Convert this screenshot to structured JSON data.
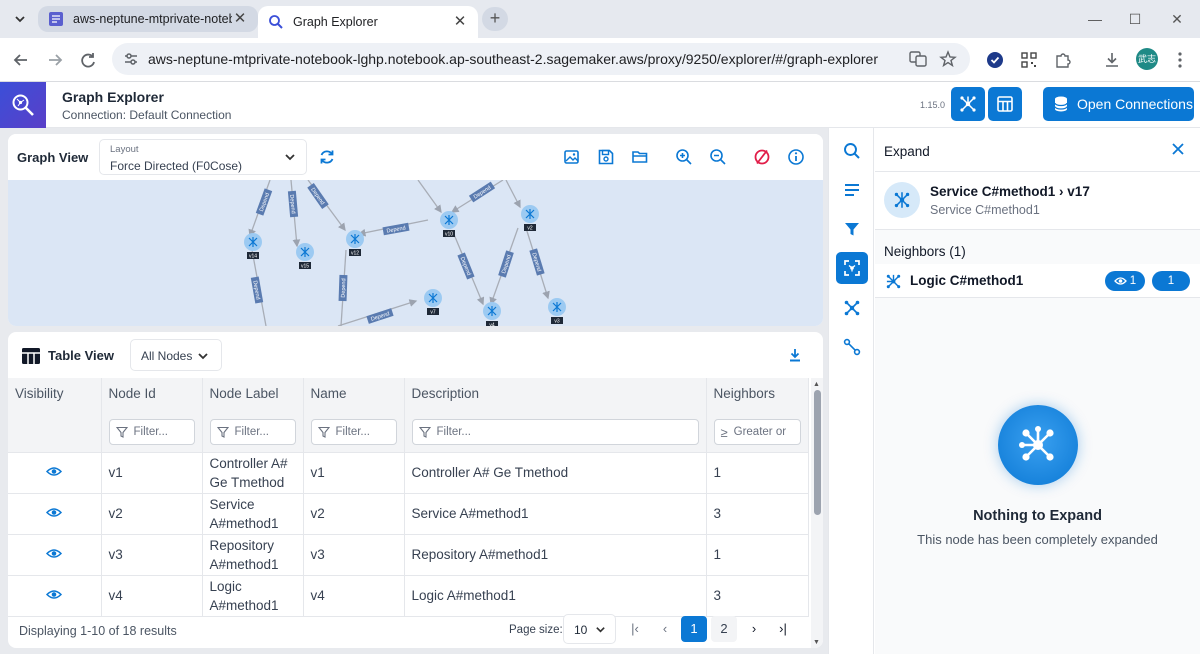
{
  "browser": {
    "tabs": [
      {
        "title": "aws-neptune-mtprivate-notebo",
        "active": false
      },
      {
        "title": "Graph Explorer",
        "active": true
      }
    ],
    "url": "aws-neptune-mtprivate-notebook-lghp.notebook.ap-southeast-2.sagemaker.aws/proxy/9250/explorer/#/graph-explorer",
    "profile_label": "武志"
  },
  "app": {
    "title": "Graph Explorer",
    "connection": "Connection: Default Connection",
    "version": "1.15.0",
    "open_connections_label": "Open Connections",
    "accent_color": "#0b78d4"
  },
  "graph_view": {
    "title": "Graph View",
    "layout_label": "Layout",
    "layout_value": "Force Directed (F0Cose)",
    "node_labels": [
      "v14",
      "v15",
      "v12",
      "v10",
      "v2",
      "v7",
      "v4",
      "v3"
    ],
    "edge_label": "Depend"
  },
  "table_view": {
    "title": "Table View",
    "filter_select": "All Nodes",
    "columns": [
      "Visibility",
      "Node Id",
      "Node Label",
      "Name",
      "Description",
      "Neighbors"
    ],
    "filter_placeholder": "Filter...",
    "neighbors_filter_placeholder": "Greater or",
    "rows": [
      {
        "id": "v1",
        "label": "Controller A# Ge Tmethod",
        "name": "v1",
        "description": "Controller A# Ge Tmethod",
        "neighbors": "1"
      },
      {
        "id": "v2",
        "label": "Service A#method1",
        "name": "v2",
        "description": "Service A#method1",
        "neighbors": "3"
      },
      {
        "id": "v3",
        "label": "Repository A#method1",
        "name": "v3",
        "description": "Repository A#method1",
        "neighbors": "1"
      },
      {
        "id": "v4",
        "label": "Logic A#method1",
        "name": "v4",
        "description": "Logic A#method1",
        "neighbors": "3"
      }
    ],
    "footer_text": "Displaying 1-10 of 18 results",
    "page_size_label": "Page size:",
    "page_size": "10",
    "pages": [
      "1",
      "2"
    ],
    "current_page": "1"
  },
  "expand_panel": {
    "title": "Expand",
    "node_title": "Service C#method1 › v17",
    "node_subtitle": "Service C#method1",
    "neighbors_heading": "Neighbors (1)",
    "neighbor_label": "Logic C#method1",
    "neighbor_visible_count": "1",
    "neighbor_count": "1",
    "empty_title": "Nothing to Expand",
    "empty_subtitle": "This node has been completely expanded"
  }
}
